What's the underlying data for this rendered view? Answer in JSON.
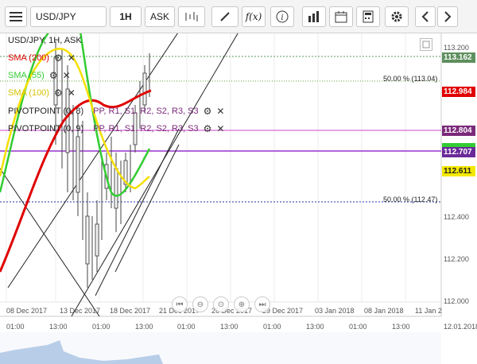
{
  "toolbar": {
    "symbol": "USD/JPY",
    "timeframe": "1H",
    "price_side": "ASK",
    "fx_label": "f(x)",
    "info_label": "i"
  },
  "legend": {
    "title": "USD/JPY, 1H, ASK",
    "sma200": "SMA (200)",
    "sma55": "SMA (55)",
    "sma100": "SMA (100)",
    "pivot1": "PIVOTPOINT (0, 8)",
    "pivot1_levels": "PP, R1, S1, R2, S2, R3, S3",
    "pivot2": "PIVOTPOINT (0, 9)",
    "pivot2_levels": "PP, R1, S1, R2, S2, R3, S3"
  },
  "price_axis": {
    "ticks": [
      "113.200",
      "112.400",
      "112.200",
      "112.000"
    ],
    "current_price": "113.162",
    "sma200_price": "112.984",
    "pivot_price": "112.804",
    "level_price": "112.707",
    "sma100_price": "112.611"
  },
  "fib_labels": {
    "upper": "50.00 % (113.04)",
    "lower": "50.00 % (112.47)"
  },
  "date_axis": [
    "08 Dec 2017",
    "13 Dec 2017",
    "18 Dec 2017",
    "21 Dec 2017",
    "26 Dec 2017",
    "29 Dec 2017",
    "03 Jan 2018",
    "08 Jan 2018",
    "11 Jan 2"
  ],
  "time_axis": [
    "01:00",
    "13:00",
    "01:00",
    "13:00",
    "01:00",
    "13:00",
    "01:00",
    "13:00",
    "01:00",
    "13:00",
    "01:00"
  ],
  "end_date": "12.01.2018",
  "colors": {
    "sma200": "#e00000",
    "sma55": "#33cc33",
    "sma100": "#f5e000",
    "pivot_line": "#cc44cc",
    "level_line": "#9933cc",
    "accent": "#1a6fb5"
  }
}
